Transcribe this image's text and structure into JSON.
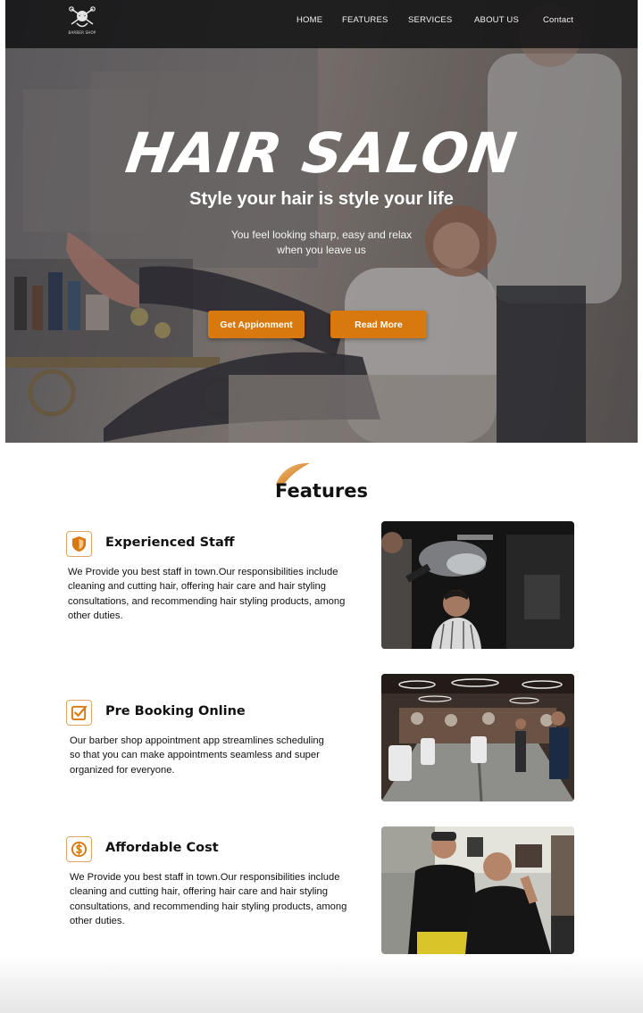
{
  "nav": {
    "logo_text": "BARBER SHOP",
    "items": [
      "HOME",
      "FEATURES",
      "SERVICES",
      "ABOUT US",
      "Contact"
    ]
  },
  "hero": {
    "title": "HAIR SALON",
    "subtitle": "Style your hair is style your life",
    "desc_line1": "You feel looking sharp, easy and relax",
    "desc_line2": "when you leave us",
    "primary_button": "Get Appionment",
    "secondary_button": "Read More"
  },
  "features": {
    "heading": "Features",
    "items": [
      {
        "title": "Experienced Staff",
        "icon": "shield-icon",
        "description": "We Provide you best staff in town.Our responsibilities include cleaning and cutting hair, offering hair care and hair styling consultations, and recommending hair styling products, among other duties."
      },
      {
        "title": "Pre Booking Online",
        "icon": "checkbox-icon",
        "description": "Our barber shop appointment app streamlines scheduling so that you can make appointments seamless and super organized for everyone."
      },
      {
        "title": "Affordable Cost",
        "icon": "dollar-coin-icon",
        "description": "We Provide you best staff in town.Our responsibilities include cleaning and cutting hair, offering hair care and hair styling consultations, and recommending hair styling products, among other duties."
      }
    ]
  },
  "colors": {
    "accent": "#d7790e",
    "icon_border": "#e0a464",
    "nav_bg": "#141416"
  }
}
